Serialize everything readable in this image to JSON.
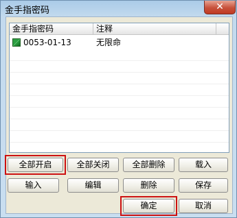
{
  "window": {
    "title": "金手指密码",
    "close_label": "✕"
  },
  "list": {
    "columns": [
      "金手指密码",
      "注释"
    ],
    "rows": [
      {
        "code": "0053-01-13",
        "note": "无限命"
      }
    ]
  },
  "buttons": {
    "enable_all": "全部开启",
    "disable_all": "全部关闭",
    "delete_all": "全部删除",
    "load": "载入",
    "input": "输入",
    "edit": "编辑",
    "delete": "删除",
    "save": "保存",
    "ok": "确定",
    "cancel": "取消"
  }
}
